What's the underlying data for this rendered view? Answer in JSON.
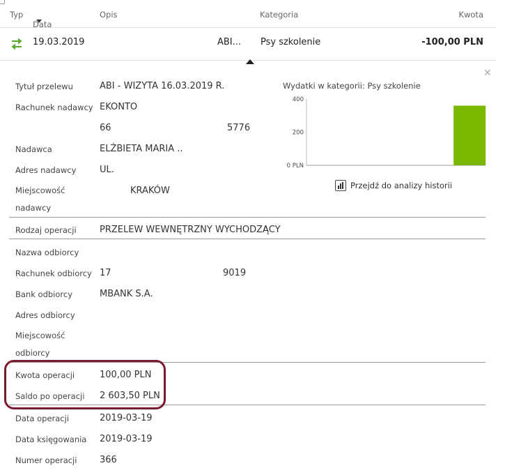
{
  "header": {
    "typ": "Typ",
    "data": "Data",
    "opis": "Opis",
    "kategoria": "Kategoria",
    "kwota": "Kwota"
  },
  "row": {
    "date": "19.03.2019",
    "opis": "ABI...",
    "kategoria": "Psy szkolenie",
    "amount": "-100,00 PLN"
  },
  "details": {
    "tytul_label": "Tytuł przelewu",
    "tytul_value": "ABI - WIZYTA 16.03.2019 R.",
    "rach_nadawcy_label": "Rachunek nadawcy",
    "rach_nadawcy_name": "EKONTO",
    "rach_nadawcy_num_start": "66",
    "rach_nadawcy_num_end": "5776",
    "nadawca_label": "Nadawca",
    "nadawca_value": "ELŻBIETA MARIA ..",
    "adres_nadawcy_label": "Adres nadawcy",
    "adres_nadawcy_value": "UL.",
    "miejscowosc_nadawcy_label_1": "Miejscowość",
    "miejscowosc_nadawcy_label_2": "nadawcy",
    "miejscowosc_nadawcy_value": "KRAKÓW",
    "rodzaj_label": "Rodzaj operacji",
    "rodzaj_value": "PRZELEW WEWNĘTRZNY WYCHODZĄCY",
    "nazwa_odbiorcy_label": "Nazwa odbiorcy",
    "rach_odbiorcy_label": "Rachunek odbiorcy",
    "rach_odbiorcy_num_start": "17",
    "rach_odbiorcy_num_end": "9019",
    "bank_label": "Bank odbiorcy",
    "bank_value": "MBANK S.A.",
    "adres_odbiorcy_label": "Adres odbiorcy",
    "miejscowosc_odbiorcy_label_1": "Miejscowość",
    "miejscowosc_odbiorcy_label_2": "odbiorcy",
    "kwota_label": "Kwota operacji",
    "kwota_value": "100,00 PLN",
    "saldo_label": "Saldo po operacji",
    "saldo_value": "2 603,50 PLN",
    "data_op_label": "Data operacji",
    "data_op_value": "2019-03-19",
    "data_ks_label": "Data księgowania",
    "data_ks_value": "2019-03-19",
    "numer_label": "Numer operacji",
    "numer_value": "366"
  },
  "chart": {
    "title": "Wydatki w kategorii:  Psy szkolenie",
    "history_link": "Przejdź do analizy historii"
  },
  "chart_data": {
    "type": "bar",
    "categories": [
      "",
      "",
      ""
    ],
    "values": [
      0,
      0,
      360
    ],
    "ylim": [
      0,
      400
    ],
    "y_ticks": [
      0,
      200,
      400
    ],
    "y_tick_labels": [
      "0 PLN",
      "200",
      "400"
    ],
    "colors": {
      "bar": "#7ab800"
    }
  },
  "colors": {
    "highlight": "#7a1a2c",
    "transfer_icon": "#5aa82a"
  }
}
